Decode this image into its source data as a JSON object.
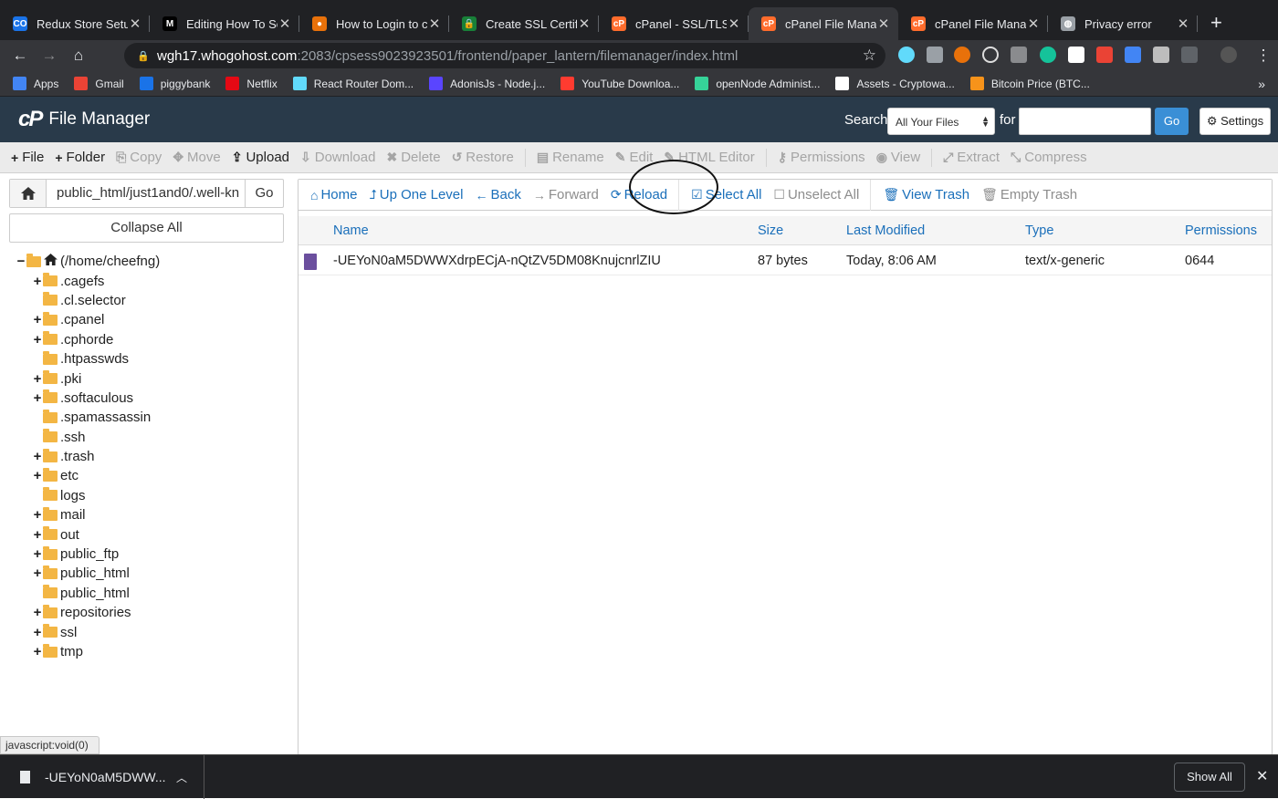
{
  "browser": {
    "tabs": [
      {
        "title": "Redux Store Setup",
        "icon": "co-icon",
        "color": "#1a73e8",
        "glyph": "CO"
      },
      {
        "title": "Editing How To Se",
        "icon": "medium-icon",
        "color": "#000000",
        "glyph": "M"
      },
      {
        "title": "How to Login to c",
        "icon": "dots-icon",
        "color": "#e8710a",
        "glyph": "●"
      },
      {
        "title": "Create SSL Certifi",
        "icon": "lock-icon",
        "color": "#188038",
        "glyph": "🔒"
      },
      {
        "title": "cPanel - SSL/TLS",
        "icon": "cpanel-icon",
        "color": "#ff6c2c",
        "glyph": "cP"
      },
      {
        "title": "cPanel File Manag",
        "icon": "cpanel-icon",
        "color": "#ff6c2c",
        "glyph": "cP"
      },
      {
        "title": "cPanel File Manag",
        "icon": "cpanel-icon",
        "color": "#ff6c2c",
        "glyph": "cP"
      },
      {
        "title": "Privacy error",
        "icon": "globe-icon",
        "color": "#9aa0a6",
        "glyph": "◍"
      }
    ],
    "url_host": "wgh17.whogohost.com",
    "url_path": ":2083/cpsess9023923501/frontend/paper_lantern/filemanager/index.html",
    "bookmarks": [
      {
        "label": "Apps",
        "color": "#4285f4"
      },
      {
        "label": "Gmail",
        "color": "#ea4335"
      },
      {
        "label": "piggybank",
        "color": "#1a73e8"
      },
      {
        "label": "Netflix",
        "color": "#e50914"
      },
      {
        "label": "React Router Dom...",
        "color": "#61dafb"
      },
      {
        "label": "AdonisJs - Node.j...",
        "color": "#5a45ff"
      },
      {
        "label": "YouTube Downloa...",
        "color": "#ff3b30"
      },
      {
        "label": "openNode Administ...",
        "color": "#36d399"
      },
      {
        "label": "Assets - Cryptowa...",
        "color": "#ffffff"
      },
      {
        "label": "Bitcoin Price (BTC...",
        "color": "#f7931a"
      }
    ]
  },
  "header": {
    "app_title": "File Manager",
    "search_label": "Search",
    "search_scope": "All Your Files",
    "for_label": "for",
    "go_label": "Go",
    "settings_label": "Settings"
  },
  "toolbar": [
    {
      "label": "File",
      "icon": "plus-icon",
      "glyph": "+",
      "enabled": true
    },
    {
      "label": "Folder",
      "icon": "plus-icon",
      "glyph": "+",
      "enabled": true
    },
    {
      "label": "Copy",
      "icon": "copy-icon",
      "glyph": "⎘",
      "enabled": false
    },
    {
      "label": "Move",
      "icon": "move-icon",
      "glyph": "✥",
      "enabled": false
    },
    {
      "label": "Upload",
      "icon": "upload-icon",
      "glyph": "⇪",
      "enabled": true
    },
    {
      "label": "Download",
      "icon": "download-icon",
      "glyph": "⇩",
      "enabled": false
    },
    {
      "label": "Delete",
      "icon": "delete-icon",
      "glyph": "✖",
      "enabled": false
    },
    {
      "label": "Restore",
      "icon": "restore-icon",
      "glyph": "↺",
      "enabled": false
    },
    {
      "label": "Rename",
      "icon": "rename-icon",
      "glyph": "▤",
      "enabled": false
    },
    {
      "label": "Edit",
      "icon": "edit-icon",
      "glyph": "✎",
      "enabled": false
    },
    {
      "label": "HTML Editor",
      "icon": "html-editor-icon",
      "glyph": "✎",
      "enabled": false
    },
    {
      "label": "Permissions",
      "icon": "key-icon",
      "glyph": "⚷",
      "enabled": false
    },
    {
      "label": "View",
      "icon": "eye-icon",
      "glyph": "◉",
      "enabled": false
    },
    {
      "label": "Extract",
      "icon": "extract-icon",
      "glyph": "⤢",
      "enabled": false
    },
    {
      "label": "Compress",
      "icon": "compress-icon",
      "glyph": "⤡",
      "enabled": false
    }
  ],
  "sidebar": {
    "path_value": "public_html/just1and0/.well-kn",
    "go_label": "Go",
    "collapse_label": "Collapse All",
    "root_label": "(/home/cheefng)",
    "folders": [
      {
        "name": ".cagefs",
        "expandable": true
      },
      {
        "name": ".cl.selector",
        "expandable": false
      },
      {
        "name": ".cpanel",
        "expandable": true
      },
      {
        "name": ".cphorde",
        "expandable": true
      },
      {
        "name": ".htpasswds",
        "expandable": false
      },
      {
        "name": ".pki",
        "expandable": true
      },
      {
        "name": ".softaculous",
        "expandable": true
      },
      {
        "name": ".spamassassin",
        "expandable": false
      },
      {
        "name": ".ssh",
        "expandable": false
      },
      {
        "name": ".trash",
        "expandable": true
      },
      {
        "name": "etc",
        "expandable": true
      },
      {
        "name": "logs",
        "expandable": false
      },
      {
        "name": "mail",
        "expandable": true
      },
      {
        "name": "out",
        "expandable": true
      },
      {
        "name": "public_ftp",
        "expandable": true
      },
      {
        "name": "public_html",
        "expandable": true
      },
      {
        "name": "public_html",
        "expandable": false
      },
      {
        "name": "repositories",
        "expandable": true
      },
      {
        "name": "ssl",
        "expandable": true
      },
      {
        "name": "tmp",
        "expandable": true
      }
    ]
  },
  "actions": [
    {
      "label": "Home",
      "icon": "home-icon",
      "glyph": "⌂",
      "enabled": true
    },
    {
      "label": "Up One Level",
      "icon": "level-up-icon",
      "glyph": "⮥",
      "enabled": true
    },
    {
      "label": "Back",
      "icon": "arrow-left-icon",
      "glyph": "←",
      "enabled": true
    },
    {
      "label": "Forward",
      "icon": "arrow-right-icon",
      "glyph": "→",
      "enabled": false
    },
    {
      "label": "Reload",
      "icon": "refresh-icon",
      "glyph": "⟳",
      "enabled": true
    },
    {
      "label": "Select All",
      "icon": "checkbox-checked-icon",
      "glyph": "☑",
      "enabled": true
    },
    {
      "label": "Unselect All",
      "icon": "checkbox-empty-icon",
      "glyph": "☐",
      "enabled": false
    },
    {
      "label": "View Trash",
      "icon": "trash-icon",
      "glyph": "🗑",
      "enabled": true
    },
    {
      "label": "Empty Trash",
      "icon": "trash-icon",
      "glyph": "🗑",
      "enabled": false
    }
  ],
  "table": {
    "columns": [
      "Name",
      "Size",
      "Last Modified",
      "Type",
      "Permissions"
    ],
    "rows": [
      {
        "name": "-UEYoN0aM5DWWXdrpECjA-nQtZV5DM08KnujcnrlZIU",
        "size": "87 bytes",
        "modified": "Today, 8:06 AM",
        "type": "text/x-generic",
        "permissions": "0644"
      }
    ]
  },
  "status_text": "javascript:void(0)",
  "downloads": {
    "item": "-UEYoN0aM5DWW...",
    "show_all": "Show All"
  }
}
